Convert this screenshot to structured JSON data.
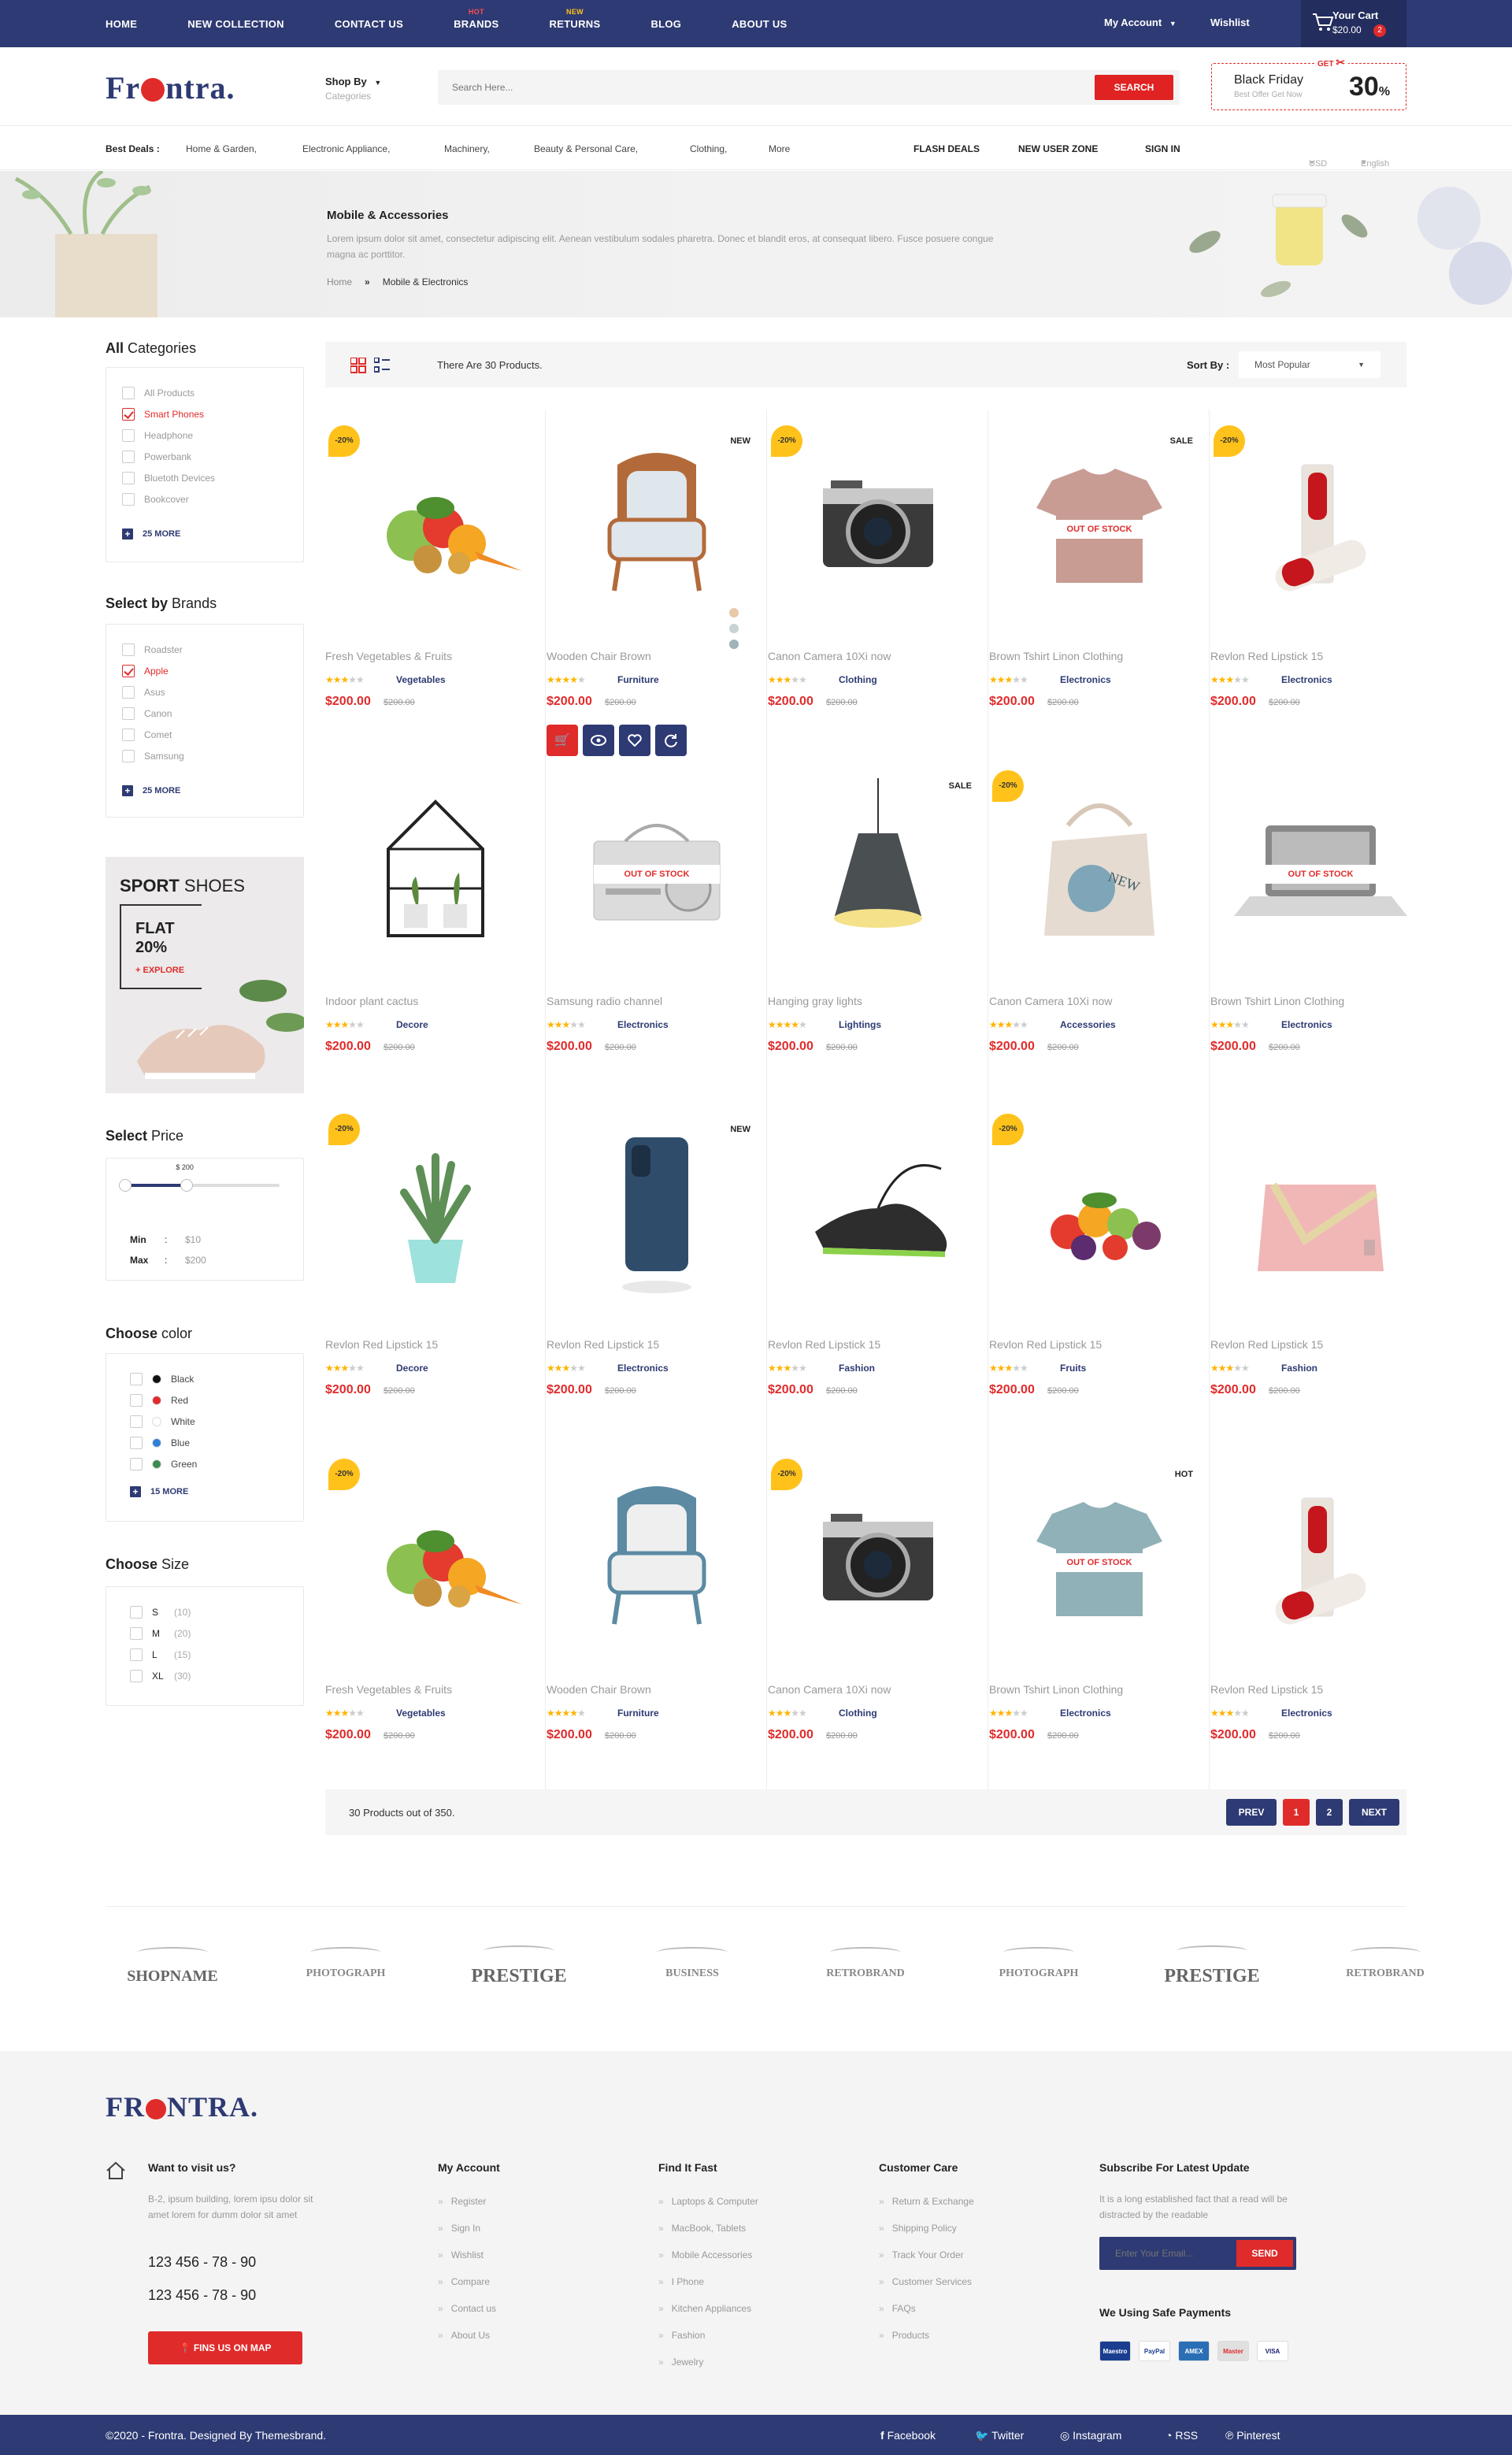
{
  "topnav": {
    "items": [
      "HOME",
      "NEW COLLECTION",
      "CONTACT US",
      "BRANDS",
      "RETURNS",
      "BLOG",
      "ABOUT US"
    ],
    "badges": {
      "brands": "HOT",
      "returns": "NEW"
    },
    "account": "My Account",
    "wishlist": "Wishlist",
    "cart_label": "Your Cart",
    "cart_total": "$20.00",
    "cart_count": "2"
  },
  "header": {
    "logo_pre": "Fr",
    "logo_post": "ntra.",
    "shop_by": "Shop By",
    "shop_by_sub": "Categories",
    "search_placeholder": "Search Here...",
    "search_button": "SEARCH",
    "promo_get": "GET",
    "promo_title": "Black Friday",
    "promo_sub": "Best Offer Get Now",
    "promo_value": "30",
    "promo_unit": "%"
  },
  "catbar": {
    "label": "Best Deals :",
    "items": [
      "Home & Garden,",
      "Electronic Appliance,",
      "Machinery,",
      "Beauty & Personal Care,",
      "Clothing,",
      "More"
    ],
    "links": [
      "FLASH DEALS",
      "NEW USER ZONE",
      "SIGN IN"
    ],
    "currency": "USD",
    "language": "English"
  },
  "hero": {
    "title": "Mobile & Accessories",
    "desc": "Lorem ipsum dolor sit amet, consectetur adipiscing elit. Aenean vestibulum sodales pharetra. Donec et blandit eros, at consequat libero. Fusce posuere congue magna ac porttitor.",
    "crumb_home": "Home",
    "crumb_sep": "»",
    "crumb_current": "Mobile & Electronics"
  },
  "sidebar": {
    "categories_title_a": "All",
    "categories_title_b": " Categories",
    "categories": [
      {
        "label": "All Products",
        "checked": false
      },
      {
        "label": "Smart Phones",
        "checked": true
      },
      {
        "label": "Headphone",
        "checked": false
      },
      {
        "label": "Powerbank",
        "checked": false
      },
      {
        "label": "Bluetoth Devices",
        "checked": false
      },
      {
        "label": "Bookcover",
        "checked": false
      }
    ],
    "categories_more": "25 MORE",
    "brands_title_a": "Select by",
    "brands_title_b": " Brands",
    "brands": [
      {
        "label": "Roadster",
        "checked": false
      },
      {
        "label": "Apple",
        "checked": true
      },
      {
        "label": "Asus",
        "checked": false
      },
      {
        "label": "Canon",
        "checked": false
      },
      {
        "label": "Comet",
        "checked": false
      },
      {
        "label": "Samsung",
        "checked": false
      }
    ],
    "brands_more": "25 MORE",
    "ad_title_a": "SPORT",
    "ad_title_b": " SHOES",
    "ad_flat": "FLAT",
    "ad_percent": "20%",
    "ad_cta": "+ EXPLORE",
    "price_title_a": "Select",
    "price_title_b": " Price",
    "price_bubble": "$ 200",
    "price_level": 0.4,
    "min_label": "Min",
    "min_value": "$10",
    "max_label": "Max",
    "max_value": "$200",
    "colon": ":",
    "color_title_a": "Choose",
    "color_title_b": " color",
    "colors": [
      {
        "label": "Black",
        "hex": "#111111"
      },
      {
        "label": "Red",
        "hex": "#e02b2b"
      },
      {
        "label": "White",
        "hex": "#ffffff"
      },
      {
        "label": "Blue",
        "hex": "#2f7fd8"
      },
      {
        "label": "Green",
        "hex": "#3c8a4f"
      }
    ],
    "colors_more": "15 MORE",
    "size_title_a": "Choose",
    "size_title_b": " Size",
    "sizes": [
      {
        "label": "S",
        "count": "(10)"
      },
      {
        "label": "M",
        "count": "(20)"
      },
      {
        "label": "L",
        "count": "(15)"
      },
      {
        "label": "XL",
        "count": "(30)"
      }
    ]
  },
  "sortbar": {
    "count_text": "There Are 30 Products.",
    "sort_label": "Sort By :",
    "sort_value": "Most Popular"
  },
  "products": [
    {
      "name": "Fresh Vegetables & Fruits",
      "category": "Vegetables",
      "price": "$200.00",
      "old": "$200.00",
      "rating": 3,
      "tag": "-20%",
      "label": "",
      "oos": false,
      "img": "veg"
    },
    {
      "name": "Wooden Chair Brown",
      "category": "Furniture",
      "price": "$200.00",
      "old": "$200.00",
      "rating": 4,
      "tag": "",
      "label": "NEW",
      "oos": false,
      "img": "chair"
    },
    {
      "name": "Canon Camera 10Xi now",
      "category": "Clothing",
      "price": "$200.00",
      "old": "$200.00",
      "rating": 3,
      "tag": "-20%",
      "label": "",
      "oos": false,
      "img": "camera"
    },
    {
      "name": "Brown Tshirt Linon Clothing",
      "category": "Electronics",
      "price": "$200.00",
      "old": "$200.00",
      "rating": 3,
      "tag": "",
      "label": "SALE",
      "oos": true,
      "img": "tshirt"
    },
    {
      "name": "Revlon Red Lipstick 15",
      "category": "Electronics",
      "price": "$200.00",
      "old": "$200.00",
      "rating": 3,
      "tag": "-20%",
      "label": "",
      "oos": false,
      "img": "lipstick"
    },
    {
      "name": "Indoor plant cactus",
      "category": "Decore",
      "price": "$200.00",
      "old": "$200.00",
      "rating": 3,
      "tag": "",
      "label": "",
      "oos": false,
      "img": "terrarium"
    },
    {
      "name": "Samsung radio channel",
      "category": "Electronics",
      "price": "$200.00",
      "old": "$200.00",
      "rating": 3,
      "tag": "",
      "label": "",
      "oos": true,
      "img": "radio"
    },
    {
      "name": "Hanging gray lights",
      "category": "Lightings",
      "price": "$200.00",
      "old": "$200.00",
      "rating": 4,
      "tag": "",
      "label": "SALE",
      "oos": false,
      "img": "lamp"
    },
    {
      "name": "Canon Camera 10Xi now",
      "category": "Accessories",
      "price": "$200.00",
      "old": "$200.00",
      "rating": 3,
      "tag": "-20%",
      "label": "",
      "oos": false,
      "img": "bag"
    },
    {
      "name": "Brown Tshirt Linon Clothing",
      "category": "Electronics",
      "price": "$200.00",
      "old": "$200.00",
      "rating": 3,
      "tag": "",
      "label": "",
      "oos": true,
      "img": "laptop"
    },
    {
      "name": "Revlon Red Lipstick 15",
      "category": "Decore",
      "price": "$200.00",
      "old": "$200.00",
      "rating": 3,
      "tag": "-20%",
      "label": "",
      "oos": false,
      "img": "plant"
    },
    {
      "name": "Revlon Red Lipstick 15",
      "category": "Electronics",
      "price": "$200.00",
      "old": "$200.00",
      "rating": 3,
      "tag": "",
      "label": "NEW",
      "oos": false,
      "img": "phone"
    },
    {
      "name": "Revlon Red Lipstick 15",
      "category": "Fashion",
      "price": "$200.00",
      "old": "$200.00",
      "rating": 3,
      "tag": "",
      "label": "",
      "oos": false,
      "img": "shoe"
    },
    {
      "name": "Revlon Red Lipstick 15",
      "category": "Fruits",
      "price": "$200.00",
      "old": "$200.00",
      "rating": 3,
      "tag": "-20%",
      "label": "",
      "oos": false,
      "img": "fruits"
    },
    {
      "name": "Revlon Red Lipstick 15",
      "category": "Fashion",
      "price": "$200.00",
      "old": "$200.00",
      "rating": 3,
      "tag": "",
      "label": "",
      "oos": false,
      "img": "purse"
    },
    {
      "name": "Fresh Vegetables & Fruits",
      "category": "Vegetables",
      "price": "$200.00",
      "old": "$200.00",
      "rating": 3,
      "tag": "-20%",
      "label": "",
      "oos": false,
      "img": "veg"
    },
    {
      "name": "Wooden Chair Brown",
      "category": "Furniture",
      "price": "$200.00",
      "old": "$200.00",
      "rating": 4,
      "tag": "",
      "label": "",
      "oos": false,
      "img": "chair2"
    },
    {
      "name": "Canon Camera 10Xi now",
      "category": "Clothing",
      "price": "$200.00",
      "old": "$200.00",
      "rating": 3,
      "tag": "-20%",
      "label": "",
      "oos": false,
      "img": "camera"
    },
    {
      "name": "Brown Tshirt Linon Clothing",
      "category": "Electronics",
      "price": "$200.00",
      "old": "$200.00",
      "rating": 3,
      "tag": "",
      "label": "HOT",
      "oos": true,
      "img": "tshirt2"
    },
    {
      "name": "Revlon Red Lipstick 15",
      "category": "Electronics",
      "price": "$200.00",
      "old": "$200.00",
      "rating": 3,
      "tag": "",
      "label": "",
      "oos": false,
      "img": "lipstick"
    }
  ],
  "oos_text": "OUT OF STOCK",
  "pagination": {
    "summary": "30 Products out of 350.",
    "prev": "PREV",
    "pages": [
      "1",
      "2"
    ],
    "next": "NEXT"
  },
  "brands": [
    "SHOPNAME",
    "PHOTOGRAPH",
    "PRESTIGE",
    "BUSINESS",
    "RETROBRAND",
    "PHOTOGRAPH",
    "PRESTIGE",
    "RETROBRAND"
  ],
  "footer": {
    "logo_pre": "FR",
    "logo_post": "NTRA.",
    "visit_title": "Want to visit us?",
    "address": "B-2, ipsum building, lorem ipsu dolor sit amet lorem for dumm dolor sit amet",
    "phone1": "123 456 - 78 - 90",
    "phone2": "123 456 - 78 - 90",
    "map_button": "FINS US ON MAP",
    "cols": [
      {
        "title": "My Account",
        "items": [
          "Register",
          "Sign In",
          "Wishlist",
          "Compare",
          "Contact us",
          "About Us"
        ]
      },
      {
        "title": "Find It Fast",
        "items": [
          "Laptops & Computer",
          "MacBook, Tablets",
          "Mobile Accessories",
          "I Phone",
          "Kitchen Appliances",
          "Fashion",
          "Jewelry"
        ]
      },
      {
        "title": "Customer Care",
        "items": [
          "Return & Exchange",
          "Shipping Policy",
          "Track Your Order",
          "Customer Services",
          "FAQs",
          "Products"
        ]
      }
    ],
    "subscribe_title": "Subscribe For Latest Update",
    "subscribe_text": "It is a long established fact that a read will be distracted by the readable",
    "email_placeholder": "Enter Your Email...",
    "send": "SEND",
    "payments_title": "We Using Safe Payments",
    "payments": [
      "Maestro",
      "PayPal",
      "AMEX",
      "Master",
      "VISA"
    ]
  },
  "bottom": {
    "copyright": "©2020 - Frontra. Designed By Themesbrand.",
    "social": [
      "Facebook",
      "Twitter",
      "Instagram",
      "RSS",
      "Pinterest"
    ]
  },
  "colors": {
    "navy": "#2e3a73",
    "red": "#e02b2b",
    "yellow": "#ffc21a"
  }
}
